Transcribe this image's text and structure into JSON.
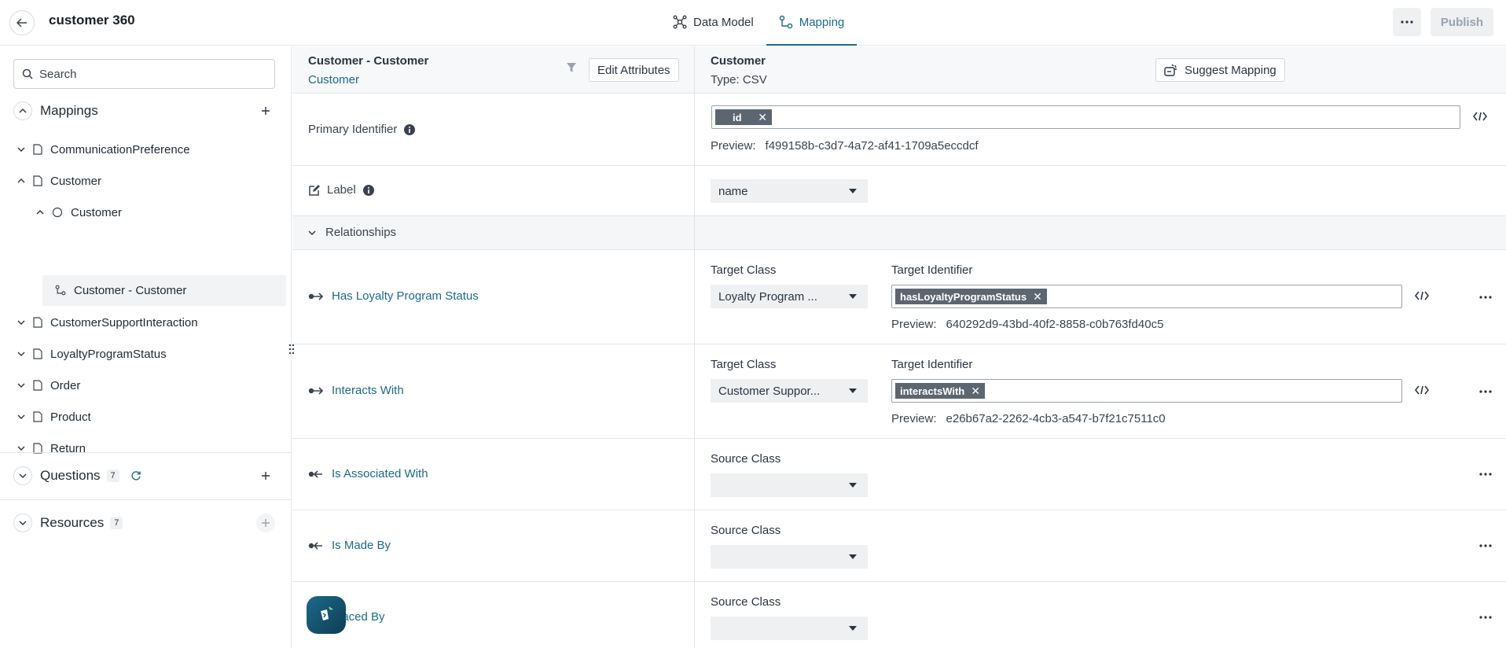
{
  "app": {
    "title": "customer 360",
    "tabs": [
      {
        "label": "Data Model",
        "icon": "network-icon",
        "active": false
      },
      {
        "label": "Mapping",
        "icon": "mapping-icon",
        "active": true
      }
    ],
    "publish_label": "Publish"
  },
  "sidebar": {
    "search_placeholder": "Search",
    "mappings_title": "Mappings",
    "tree": [
      {
        "label": "CommunicationPreference",
        "icon": "file-icon",
        "expanded": false
      },
      {
        "label": "Customer",
        "icon": "file-icon",
        "expanded": true
      },
      {
        "label": "Customer",
        "icon": "circle-icon",
        "expanded": true
      },
      {
        "label": "Customer - Customer",
        "icon": "mapping-icon",
        "selected": true
      },
      {
        "label": "CustomerSupportInteraction",
        "icon": "file-icon",
        "expanded": false
      },
      {
        "label": "LoyaltyProgramStatus",
        "icon": "file-icon",
        "expanded": false
      },
      {
        "label": "Order",
        "icon": "file-icon",
        "expanded": false
      },
      {
        "label": "Product",
        "icon": "file-icon",
        "expanded": false
      },
      {
        "label": "Return",
        "icon": "file-icon",
        "expanded": false
      }
    ],
    "questions_title": "Questions",
    "questions_count": "7",
    "resources_title": "Resources",
    "resources_count": "7"
  },
  "main": {
    "left_header_title": "Customer - Customer",
    "left_header_sub": "Customer",
    "edit_attributes_label": "Edit Attributes",
    "right_header_title": "Customer",
    "right_header_type": "Type: CSV",
    "suggest_mapping_label": "Suggest Mapping",
    "primary_identifier": {
      "label": "Primary Identifier",
      "chip": "id",
      "preview_label": "Preview:",
      "preview_value": "f499158b-c3d7-4a72-af41-1709a5eccdcf"
    },
    "label_row": {
      "label": "Label",
      "value": "name"
    },
    "relationships_title": "Relationships",
    "relationships": [
      {
        "name": "Has Loyalty Program Status",
        "direction": "outgoing",
        "class_label": "Target Class",
        "class_value": "Loyalty Program ...",
        "identifier_label": "Target Identifier",
        "chip": "hasLoyaltyProgramStatus",
        "preview_label": "Preview:",
        "preview_value": "640292d9-43bd-40f2-8858-c0b763fd40c5"
      },
      {
        "name": "Interacts With",
        "direction": "outgoing",
        "class_label": "Target Class",
        "class_value": "Customer Suppor...",
        "identifier_label": "Target Identifier",
        "chip": "interactsWith",
        "preview_label": "Preview:",
        "preview_value": "e26b67a2-2262-4cb3-a547-b7f21c7511c0"
      },
      {
        "name": "Is Associated With",
        "direction": "incoming",
        "class_label": "Source Class",
        "class_value": ""
      },
      {
        "name": "Is Made By",
        "direction": "incoming",
        "class_label": "Source Class",
        "class_value": ""
      },
      {
        "name": "Placed By",
        "direction": "incoming",
        "class_label": "Source Class",
        "class_value": ""
      }
    ]
  },
  "colors": {
    "accent": "#1b6a8a",
    "chip_bg": "#5c6670",
    "border": "#e3e6ea"
  }
}
